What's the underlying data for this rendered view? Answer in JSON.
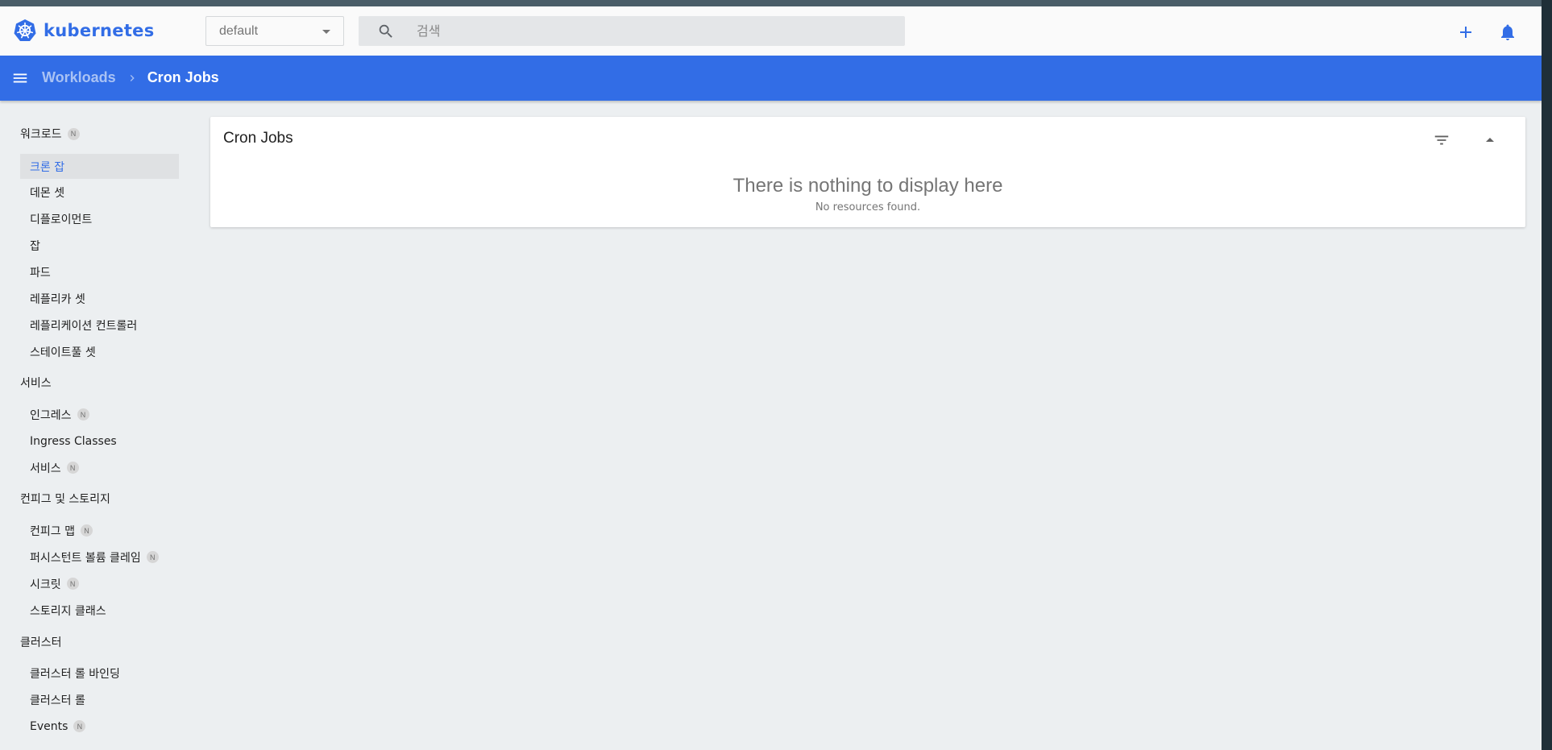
{
  "app": {
    "brand": "kubernetes",
    "brand_color": "#326de6",
    "bar_color": "#326de6"
  },
  "toolbar": {
    "namespace": "default",
    "search_placeholder": "검색",
    "icons": [
      "kubernetes-logo-icon",
      "search-icon",
      "plus-icon",
      "bell-icon"
    ]
  },
  "breadcrumb": {
    "parent": "Workloads",
    "current": "Cron Jobs"
  },
  "sidebar": {
    "sections": [
      {
        "label": "워크로드",
        "badge": "N",
        "items": [
          {
            "label": "크론 잡",
            "active": true
          },
          {
            "label": "데몬 셋"
          },
          {
            "label": "디플로이먼트"
          },
          {
            "label": "잡"
          },
          {
            "label": "파드"
          },
          {
            "label": "레플리카 셋"
          },
          {
            "label": "레플리케이션 컨트롤러"
          },
          {
            "label": "스테이트풀 셋"
          }
        ]
      },
      {
        "label": "서비스",
        "items": [
          {
            "label": "인그레스",
            "badge": "N"
          },
          {
            "label": "Ingress Classes"
          },
          {
            "label": "서비스",
            "badge": "N"
          }
        ]
      },
      {
        "label": "컨피그 및 스토리지",
        "items": [
          {
            "label": "컨피그 맵",
            "badge": "N"
          },
          {
            "label": "퍼시스턴트 볼륨 클레임",
            "badge": "N"
          },
          {
            "label": "시크릿",
            "badge": "N"
          },
          {
            "label": "스토리지 클래스"
          }
        ]
      },
      {
        "label": "클러스터",
        "items": [
          {
            "label": "클러스터 롤 바인딩"
          },
          {
            "label": "클러스터 롤"
          },
          {
            "label": "Events",
            "badge": "N"
          }
        ]
      }
    ]
  },
  "main": {
    "card_title": "Cron Jobs",
    "empty_title": "There is nothing to display here",
    "empty_subtitle": "No resources found."
  }
}
